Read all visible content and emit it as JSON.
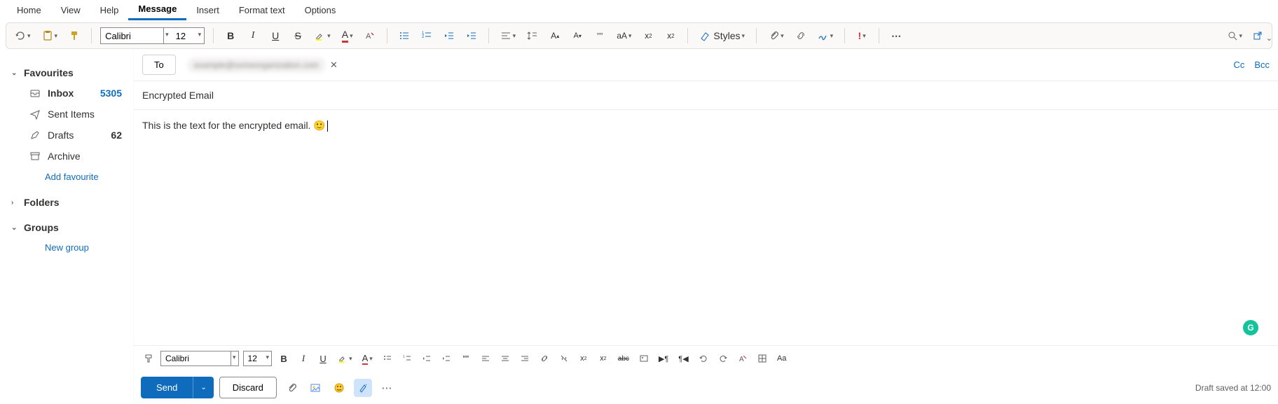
{
  "tabs": [
    "Home",
    "View",
    "Help",
    "Message",
    "Insert",
    "Format text",
    "Options"
  ],
  "active_tab": 3,
  "ribbon": {
    "font_name": "Calibri",
    "font_size": "12",
    "styles_label": "Styles"
  },
  "sidebar": {
    "favourites_label": "Favourites",
    "folders_label": "Folders",
    "groups_label": "Groups",
    "inbox_label": "Inbox",
    "inbox_count": "5305",
    "sent_label": "Sent Items",
    "drafts_label": "Drafts",
    "drafts_count": "62",
    "archive_label": "Archive",
    "add_fav_label": "Add favourite",
    "new_group_label": "New group"
  },
  "compose": {
    "to_label": "To",
    "recipient": "example@someorganization.com",
    "cc_label": "Cc",
    "bcc_label": "Bcc",
    "subject": "Encrypted Email",
    "body": "This is the text for the encrypted email.  🙂",
    "send_label": "Send",
    "discard_label": "Discard",
    "status": "Draft saved at 12:00"
  },
  "lower_tb": {
    "font_name": "Calibri",
    "font_size": "12"
  }
}
